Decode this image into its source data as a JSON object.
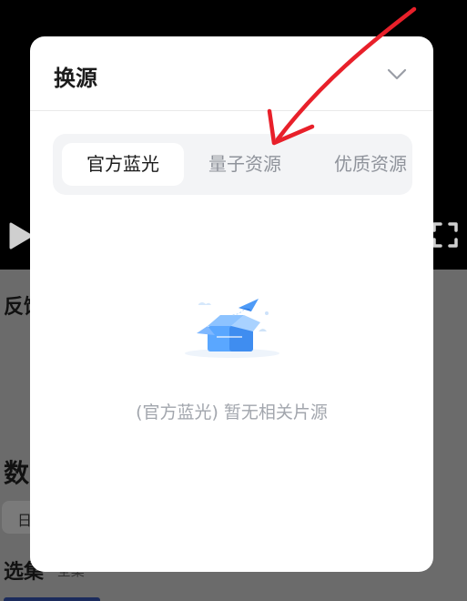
{
  "background": {
    "feedback_label": "反馈",
    "data_label": "数",
    "chip_label": "日",
    "episodes_label": "选集",
    "episodes_sub": "·全集 ·"
  },
  "modal": {
    "title": "换源",
    "tabs": [
      {
        "label": "官方蓝光",
        "active": true
      },
      {
        "label": "量子资源",
        "active": false
      },
      {
        "label": "优质资源",
        "active": false
      }
    ],
    "empty_message": "(官方蓝光) 暂无相关片源"
  },
  "colors": {
    "accent_arrow": "#e8202a",
    "tab_active_bg": "#ffffff",
    "tab_bar_bg": "#f3f4f6",
    "box_blue": "#5aa7ff"
  },
  "icons": [
    "play-icon",
    "fullscreen-icon",
    "chevron-down-icon",
    "empty-box-icon",
    "paper-plane-icon"
  ]
}
